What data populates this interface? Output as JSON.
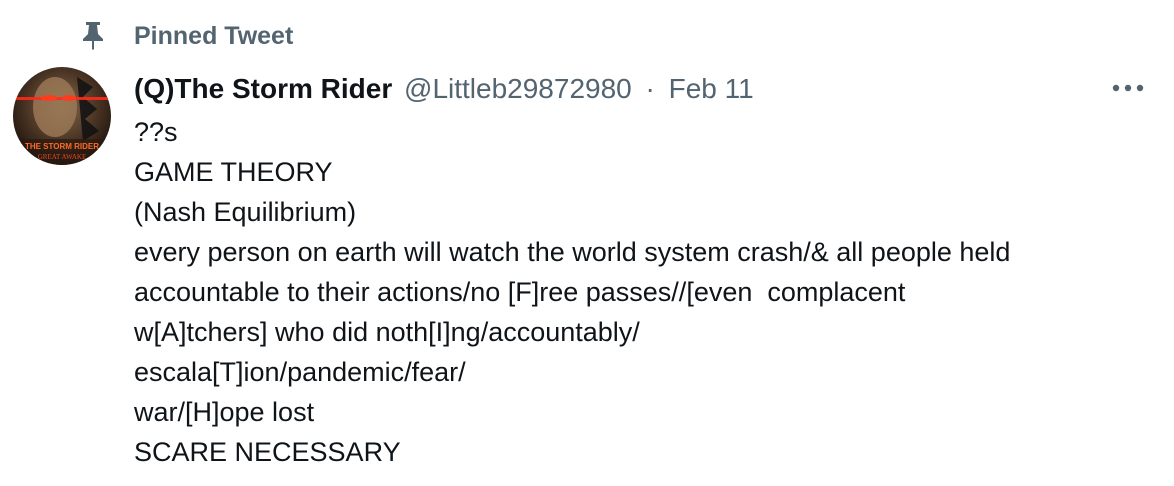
{
  "pinned": {
    "icon": "pin-icon",
    "label": "Pinned Tweet"
  },
  "tweet": {
    "avatar": {
      "icon": "avatar-image",
      "caption_top": "THE STORM RIDER",
      "caption_bottom": "GREAT AWAKE"
    },
    "display_name": "(Q)The Storm Rider",
    "handle": "@Littleb29872980",
    "separator": "·",
    "date": "Feb 11",
    "more_icon": "more-options-icon",
    "lines": [
      "??s",
      "GAME THEORY",
      "(Nash Equilibrium)",
      "every person on earth will watch the world system crash/& all people held",
      "accountable to their actions/no [F]ree passes//[even  complacent",
      "w[A]tchers] who did noth[I]ng/accountably/",
      "escala[T]ion/pandemic/fear/",
      "war/[H]ope lost",
      "SCARE NECESSARY"
    ]
  },
  "colors": {
    "text_primary": "#0f1419",
    "text_secondary": "#536471",
    "background": "#ffffff"
  }
}
